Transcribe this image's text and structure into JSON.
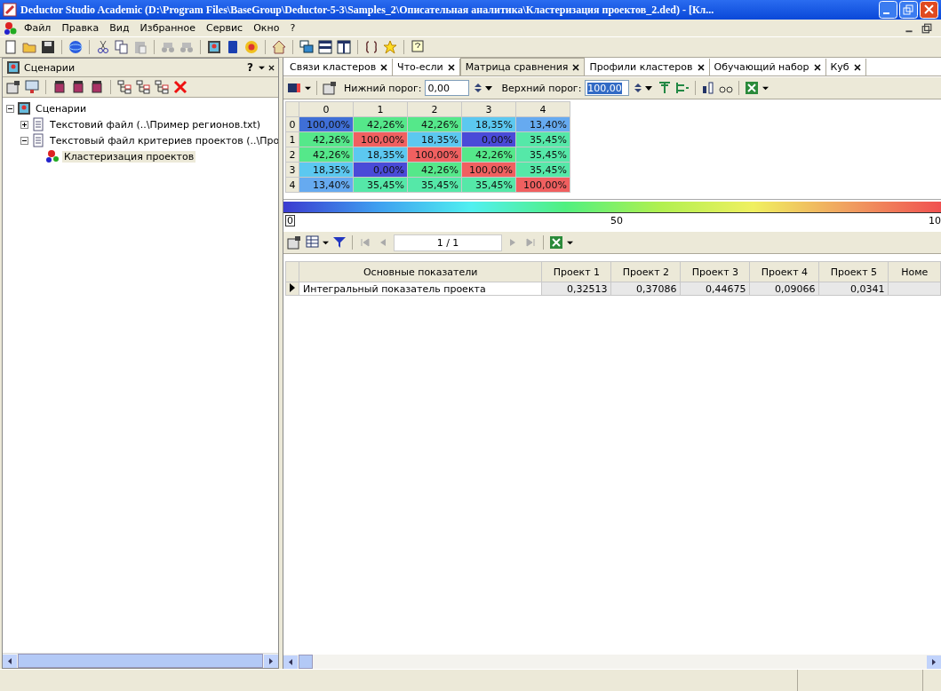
{
  "window": {
    "title": "Deductor Studio Academic (D:\\Program Files\\BaseGroup\\Deductor-5-3\\Samples_2\\Описательная аналитика\\Кластеризация проектов_2.ded) - [Кл..."
  },
  "menu": [
    "Файл",
    "Правка",
    "Вид",
    "Избранное",
    "Сервис",
    "Окно",
    "?"
  ],
  "left_panel": {
    "title": "Сценарии",
    "help": "?",
    "tree": [
      {
        "label": "Сценарии",
        "expanded": true,
        "selected": false,
        "children": [
          {
            "label": "Текстовий файл (..\\Пример регионов.txt)",
            "expanded": false,
            "selected": false
          },
          {
            "label": "Текстовый файл критериев проектов (..\\Про",
            "expanded": true,
            "selected": false,
            "children": [
              {
                "label": "Кластеризация проектов",
                "selected": true
              }
            ]
          }
        ]
      }
    ]
  },
  "tabs": [
    {
      "label": "Связи кластеров",
      "selected": false
    },
    {
      "label": "Что-если",
      "selected": false
    },
    {
      "label": "Матрица сравнения",
      "selected": true
    },
    {
      "label": "Профили кластеров",
      "selected": false
    },
    {
      "label": "Обучающий набор",
      "selected": false
    },
    {
      "label": "Куб",
      "selected": false
    }
  ],
  "thresholds": {
    "lower_label": "Нижний порог:",
    "lower_value": "0,00",
    "upper_label": "Верхний порог:",
    "upper_value": "100,00"
  },
  "matrix": {
    "columns": [
      "0",
      "1",
      "2",
      "3",
      "4"
    ],
    "rows": [
      {
        "label": "0",
        "cells": [
          {
            "text": "100,00%",
            "color": "#3f6fd6"
          },
          {
            "text": "42,26%",
            "color": "#55e88a"
          },
          {
            "text": "42,26%",
            "color": "#55e88a"
          },
          {
            "text": "18,35%",
            "color": "#5cc8f0"
          },
          {
            "text": "13,40%",
            "color": "#66aaf0"
          }
        ]
      },
      {
        "label": "1",
        "cells": [
          {
            "text": "42,26%",
            "color": "#55e88a"
          },
          {
            "text": "100,00%",
            "color": "#f06060"
          },
          {
            "text": "18,35%",
            "color": "#5cc8f0"
          },
          {
            "text": "0,00%",
            "color": "#4a4ad8"
          },
          {
            "text": "35,45%",
            "color": "#55e8a8"
          }
        ]
      },
      {
        "label": "2",
        "cells": [
          {
            "text": "42,26%",
            "color": "#55e88a"
          },
          {
            "text": "18,35%",
            "color": "#5cc8f0"
          },
          {
            "text": "100,00%",
            "color": "#f06060"
          },
          {
            "text": "42,26%",
            "color": "#55e88a"
          },
          {
            "text": "35,45%",
            "color": "#55e8a8"
          }
        ]
      },
      {
        "label": "3",
        "cells": [
          {
            "text": "18,35%",
            "color": "#5cc8f0"
          },
          {
            "text": "0,00%",
            "color": "#4a4ad8"
          },
          {
            "text": "42,26%",
            "color": "#55e88a"
          },
          {
            "text": "100,00%",
            "color": "#f06060"
          },
          {
            "text": "35,45%",
            "color": "#55e8a8"
          }
        ]
      },
      {
        "label": "4",
        "cells": [
          {
            "text": "13,40%",
            "color": "#66aaf0"
          },
          {
            "text": "35,45%",
            "color": "#55e8a8"
          },
          {
            "text": "35,45%",
            "color": "#55e8a8"
          },
          {
            "text": "35,45%",
            "color": "#55e8a8"
          },
          {
            "text": "100,00%",
            "color": "#f06060"
          }
        ]
      }
    ]
  },
  "scale": {
    "min": "0",
    "mid": "50",
    "max": "10"
  },
  "pager": "1 / 1",
  "table": {
    "columns": [
      "Основные показатели",
      "Проект 1",
      "Проект 2",
      "Проект 3",
      "Проект 4",
      "Проект 5",
      "Номе"
    ],
    "rows": [
      {
        "cells": [
          "Интегральный показатель проекта",
          "0,32513",
          "0,37086",
          "0,44675",
          "0,09066",
          "0,0341",
          ""
        ]
      }
    ]
  }
}
